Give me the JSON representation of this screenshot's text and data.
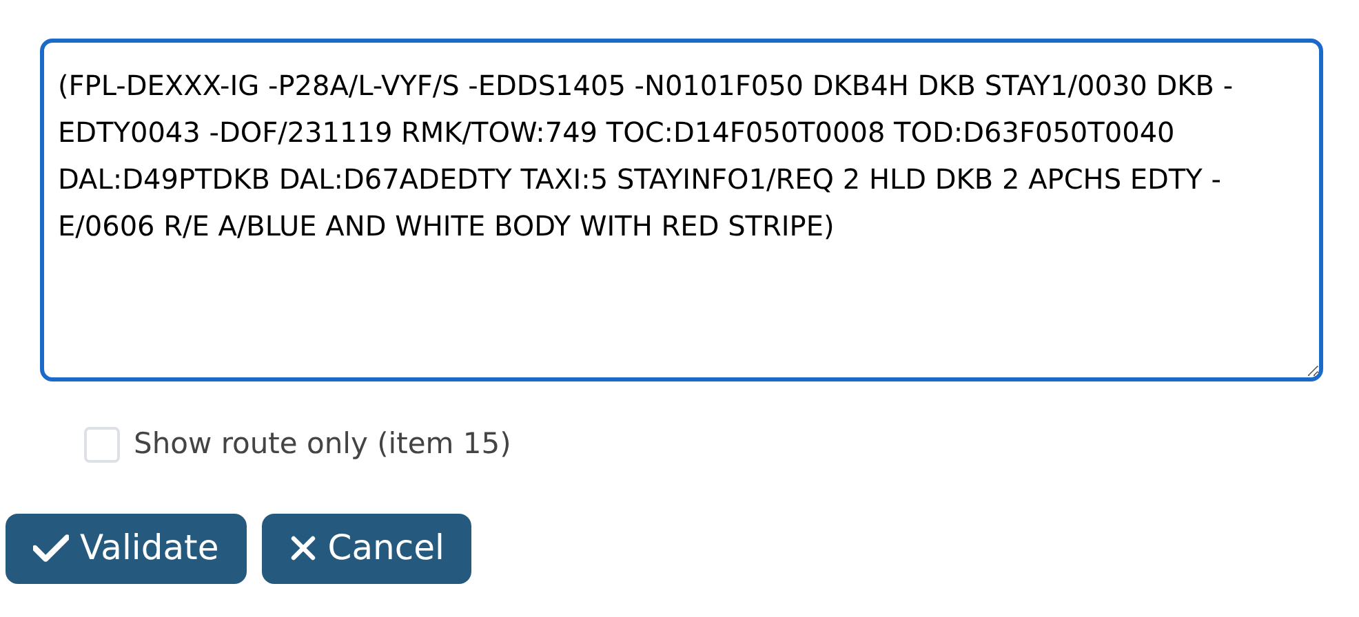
{
  "flight_plan": {
    "value": "(FPL-DEXXX-IG -P28A/L-VYF/S -EDDS1405 -N0101F050 DKB4H DKB STAY1/0030 DKB -EDTY0043 -DOF/231119 RMK/TOW:749 TOC:D14F050T0008 TOD:D63F050T0040 DAL:D49PTDKB DAL:D67ADEDTY TAXI:5 STAYINFO1/REQ 2 HLD DKB 2 APCHS EDTY -E/0606 R/E A/BLUE AND WHITE BODY WITH RED STRIPE)"
  },
  "route_only": {
    "label": "Show route only (item 15)",
    "checked": false
  },
  "buttons": [
    {
      "kind": "validate",
      "label": "Validate"
    },
    {
      "kind": "cancel",
      "label": "Cancel"
    }
  ]
}
